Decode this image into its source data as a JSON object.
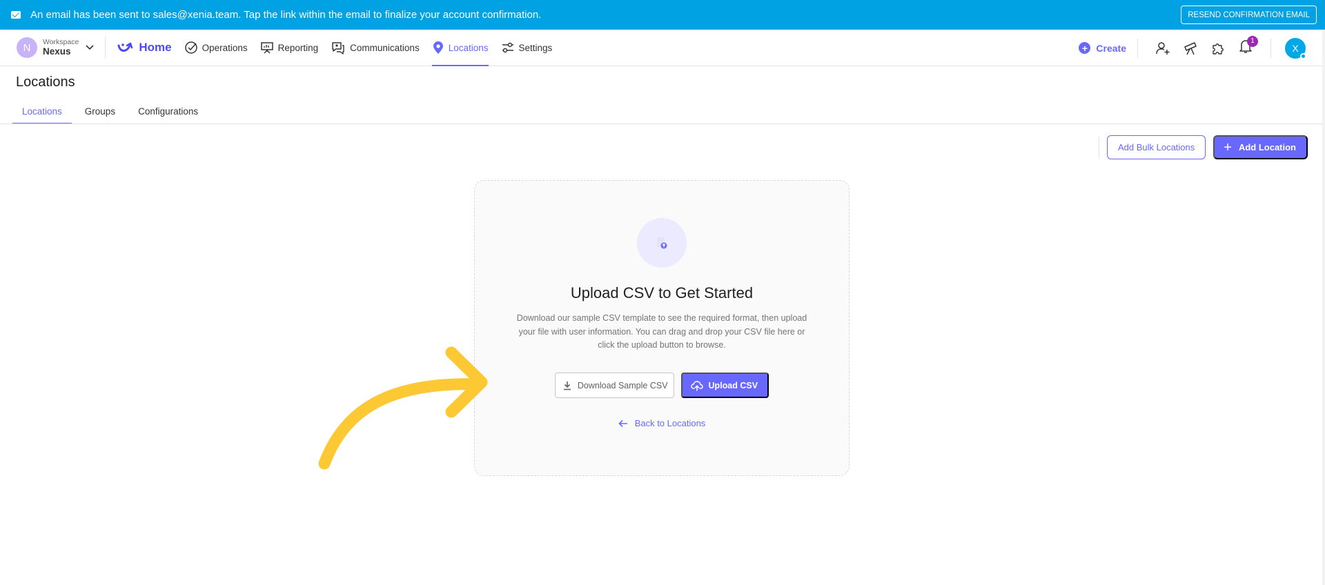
{
  "banner": {
    "message": "An email has been sent to sales@xenia.team. Tap the link within the email to finalize your account confirmation.",
    "resend_label": "RESEND CONFIRMATION EMAIL",
    "background": "#00a2e3"
  },
  "workspace": {
    "avatar_letter": "N",
    "label": "Workspace",
    "name": "Nexus"
  },
  "nav": {
    "home": "Home",
    "operations": "Operations",
    "reporting": "Reporting",
    "communications": "Communications",
    "locations": "Locations",
    "settings": "Settings",
    "active": "Locations"
  },
  "topright": {
    "create_label": "Create",
    "notification_count": "1",
    "user_initial": "X"
  },
  "page": {
    "title": "Locations",
    "tabs": [
      "Locations",
      "Groups",
      "Configurations"
    ],
    "active_tab": "Locations"
  },
  "actions": {
    "bulk_label": "Add Bulk Locations",
    "add_label": "Add Location"
  },
  "upload_card": {
    "title": "Upload CSV to Get Started",
    "description": "Download our sample CSV template to see the required format, then upload your file with user information. You can drag and drop your CSV file here or click the upload button to browse.",
    "download_label": "Download Sample CSV",
    "upload_label": "Upload CSV",
    "back_label": "Back to Locations"
  },
  "colors": {
    "accent": "#6868fe",
    "annotation_arrow": "#fcc834"
  },
  "icons": [
    "mail-icon",
    "chevron-down-icon",
    "home-logo-icon",
    "check-circle-icon",
    "presentation-icon",
    "chat-icon",
    "location-pin-icon",
    "sliders-icon",
    "plus-circle-icon",
    "add-user-icon",
    "telescope-icon",
    "puzzle-icon",
    "bell-icon",
    "file-upload-icon",
    "download-icon",
    "cloud-upload-icon",
    "arrow-left-icon"
  ]
}
